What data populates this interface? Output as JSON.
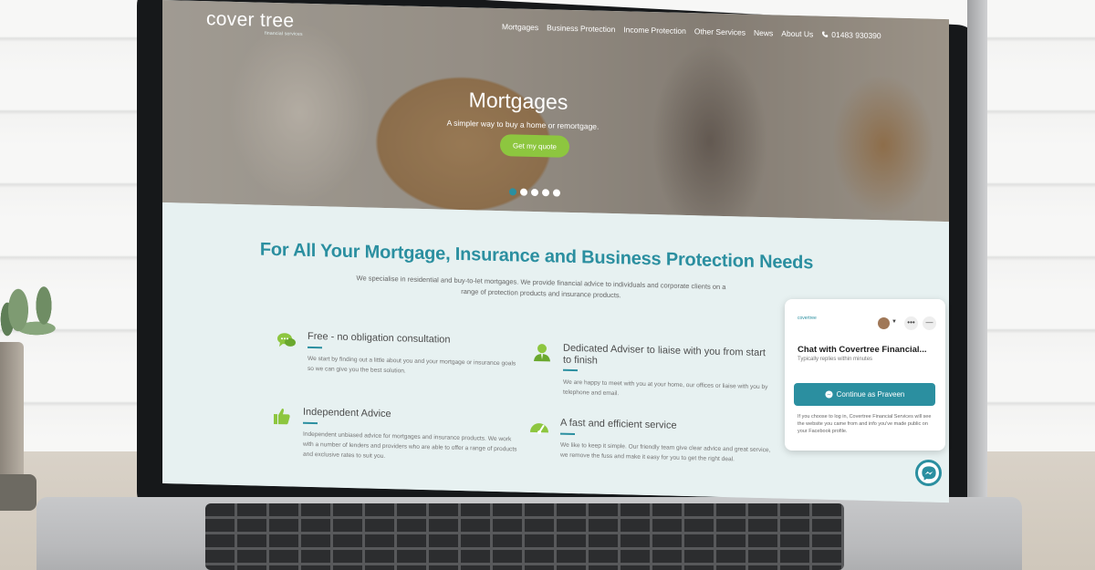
{
  "site": {
    "logo_text": "cover tree",
    "logo_subtitle": "financial services"
  },
  "nav": {
    "items": [
      "Mortgages",
      "Business Protection",
      "Income Protection",
      "Other Services",
      "News",
      "About Us"
    ],
    "phone": "01483 930390"
  },
  "hero": {
    "title": "Mortgages",
    "subtitle": "A simpler way to buy a home or remortgage.",
    "cta_label": "Get my quote",
    "slide_count": 5,
    "active_slide": 1
  },
  "main": {
    "headline": "For All Your Mortgage, Insurance and Business Protection Needs",
    "intro": "We specialise in residential and buy-to-let mortgages. We provide financial advice to individuals and corporate clients on a range of protection products and insurance products.",
    "features": [
      {
        "icon": "chat-bubbles-icon",
        "title": "Free - no obligation consultation",
        "desc": "We start by finding out a little about you and your mortgage or insurance goals so we can give you the best solution."
      },
      {
        "icon": "adviser-icon",
        "title": "Dedicated Adviser to liaise with you from start to finish",
        "desc": "We are happy to meet with you at your home, our offices or liaise with you by telephone and email."
      },
      {
        "icon": "thumbs-up-icon",
        "title": "Independent Advice",
        "desc": "Independent unbiased advice for mortgages and insurance products. We work with a number of lenders and providers who are able to offer a range of products and exclusive rates to suit you."
      },
      {
        "icon": "speedometer-icon",
        "title": "A fast and efficient service",
        "desc": "We like to keep it simple. Our friendly team give clear advice and great service, we remove the fuss and make it easy for you to get the right deal."
      }
    ]
  },
  "chat": {
    "logo": "covertree",
    "title": "Chat with Covertree Financial...",
    "subtitle": "Typically replies within minutes",
    "button_label": "Continue as Praveen",
    "note": "If you choose to log in, Covertree Financial Services will see the website you came from and info you've made public on your Facebook profile.",
    "more": "•••",
    "minimize": "—"
  },
  "colors": {
    "brand_teal": "#2b8fa0",
    "cta_green": "#8dc63f",
    "content_bg": "#e7f1f1"
  }
}
